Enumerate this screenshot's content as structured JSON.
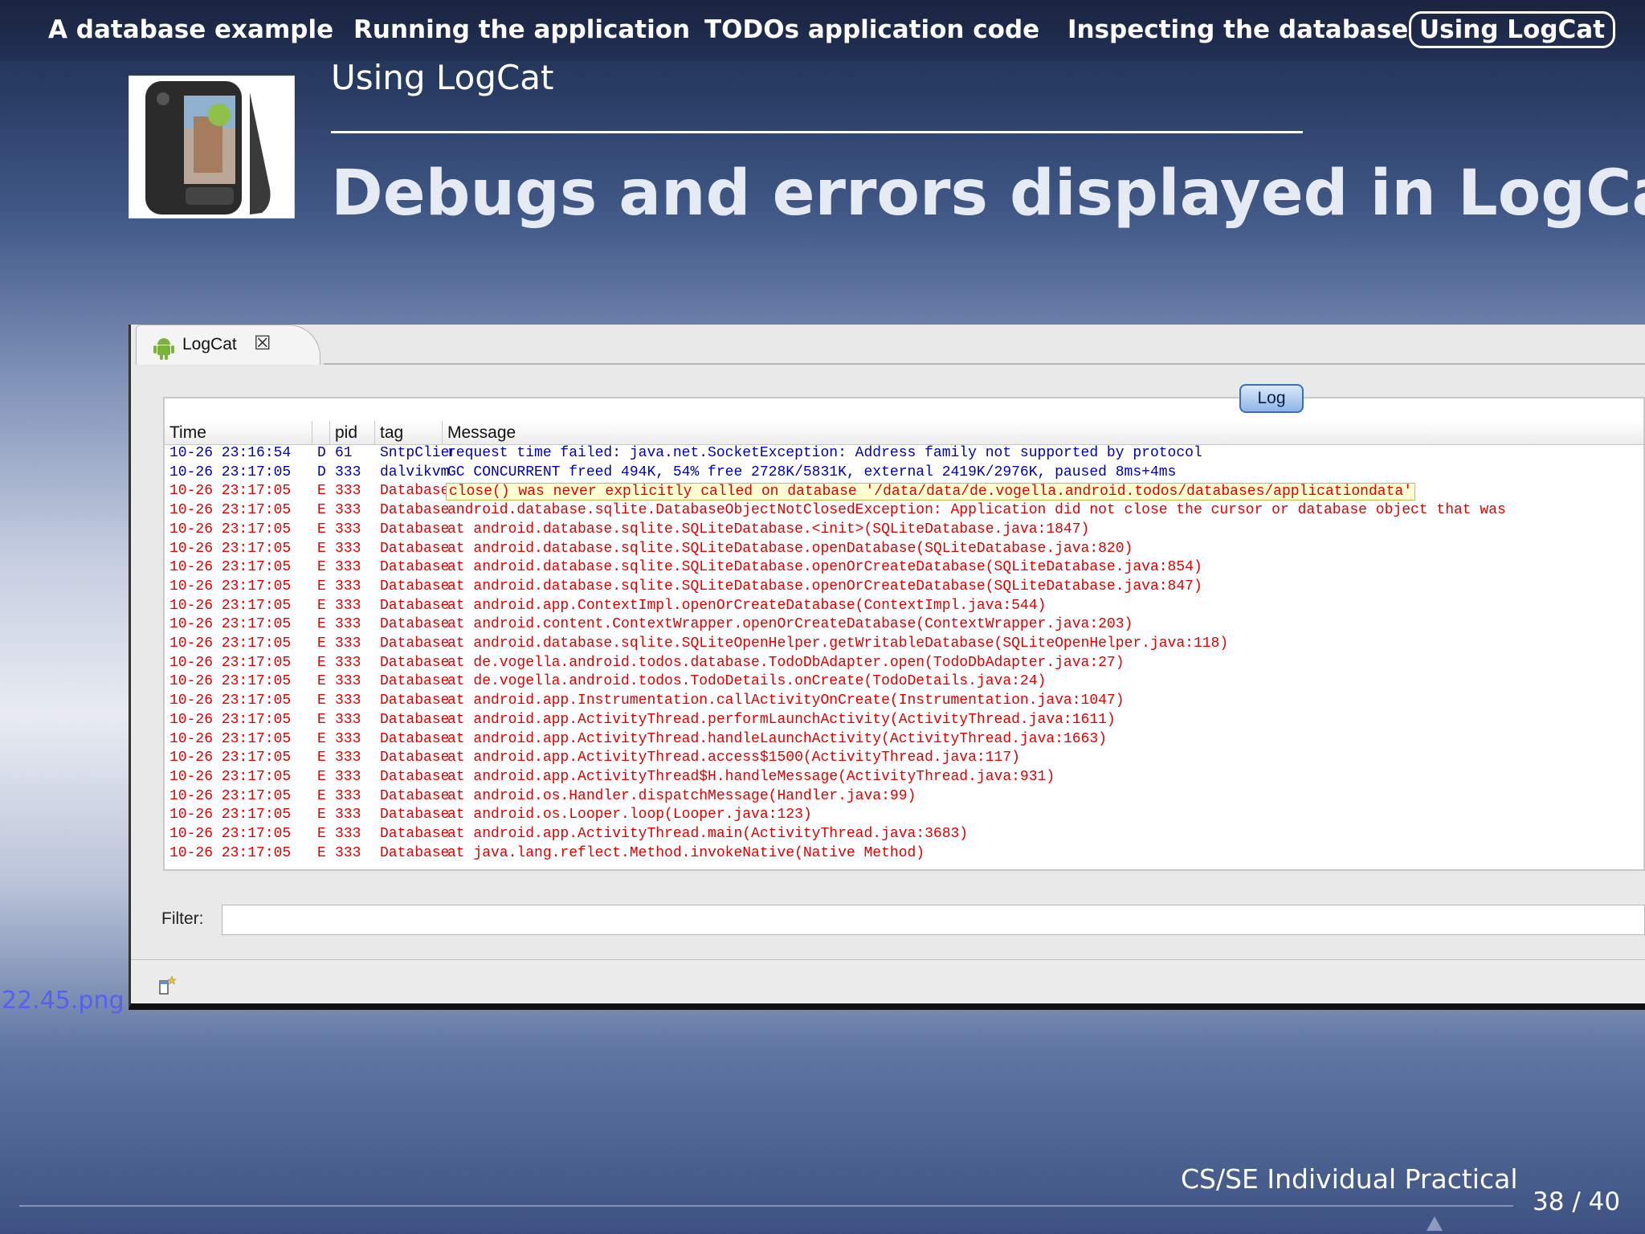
{
  "nav": {
    "items": [
      {
        "label": "A database example"
      },
      {
        "label": "Running the application"
      },
      {
        "label": "TODOs application code"
      },
      {
        "label": "Inspecting the database"
      },
      {
        "label": "Using LogCat"
      }
    ],
    "active_index": 4
  },
  "slide": {
    "subtitle": "Using LogCat",
    "title": "Debugs and errors displayed in LogCat",
    "image_caption": "22.45.png",
    "footer": "CS/SE Individual Practical",
    "page_current": "38",
    "page_separator": "/",
    "page_total": "40"
  },
  "logcat": {
    "tab_label": "LogCat",
    "log_button": "Log",
    "columns": [
      "Time",
      "pid",
      "tag",
      "Message"
    ],
    "filter_label": "Filter:",
    "filter_value": "",
    "rows": [
      {
        "time": "10-26 23:16:54",
        "level": "D",
        "pid": "61",
        "tag": "SntpClient",
        "msg": "request time failed: java.net.SocketException: Address family not supported by protocol",
        "color": "#0000b0"
      },
      {
        "time": "10-26 23:17:05",
        "level": "D",
        "pid": "333",
        "tag": "dalvikvm",
        "msg": "GC CONCURRENT freed 494K, 54% free 2728K/5831K, external 2419K/2976K, paused 8ms+4ms",
        "color": "#0000b0"
      },
      {
        "time": "10-26 23:17:05",
        "level": "E",
        "pid": "333",
        "tag": "Database",
        "msg": "close() was never explicitly called on database '/data/data/de.vogella.android.todos/databases/applicationdata'",
        "color": "#e00000",
        "highlight": true
      },
      {
        "time": "10-26 23:17:05",
        "level": "E",
        "pid": "333",
        "tag": "Database",
        "msg": "android.database.sqlite.DatabaseObjectNotClosedException: Application did not close the cursor or database object that was",
        "color": "#e00000"
      },
      {
        "time": "10-26 23:17:05",
        "level": "E",
        "pid": "333",
        "tag": "Database",
        "msg": "    at android.database.sqlite.SQLiteDatabase.<init>(SQLiteDatabase.java:1847)",
        "color": "#e00000"
      },
      {
        "time": "10-26 23:17:05",
        "level": "E",
        "pid": "333",
        "tag": "Database",
        "msg": "    at android.database.sqlite.SQLiteDatabase.openDatabase(SQLiteDatabase.java:820)",
        "color": "#e00000"
      },
      {
        "time": "10-26 23:17:05",
        "level": "E",
        "pid": "333",
        "tag": "Database",
        "msg": "    at android.database.sqlite.SQLiteDatabase.openOrCreateDatabase(SQLiteDatabase.java:854)",
        "color": "#e00000"
      },
      {
        "time": "10-26 23:17:05",
        "level": "E",
        "pid": "333",
        "tag": "Database",
        "msg": "    at android.database.sqlite.SQLiteDatabase.openOrCreateDatabase(SQLiteDatabase.java:847)",
        "color": "#e00000"
      },
      {
        "time": "10-26 23:17:05",
        "level": "E",
        "pid": "333",
        "tag": "Database",
        "msg": "    at android.app.ContextImpl.openOrCreateDatabase(ContextImpl.java:544)",
        "color": "#e00000"
      },
      {
        "time": "10-26 23:17:05",
        "level": "E",
        "pid": "333",
        "tag": "Database",
        "msg": "    at android.content.ContextWrapper.openOrCreateDatabase(ContextWrapper.java:203)",
        "color": "#e00000"
      },
      {
        "time": "10-26 23:17:05",
        "level": "E",
        "pid": "333",
        "tag": "Database",
        "msg": "    at android.database.sqlite.SQLiteOpenHelper.getWritableDatabase(SQLiteOpenHelper.java:118)",
        "color": "#e00000"
      },
      {
        "time": "10-26 23:17:05",
        "level": "E",
        "pid": "333",
        "tag": "Database",
        "msg": "    at de.vogella.android.todos.database.TodoDbAdapter.open(TodoDbAdapter.java:27)",
        "color": "#e00000"
      },
      {
        "time": "10-26 23:17:05",
        "level": "E",
        "pid": "333",
        "tag": "Database",
        "msg": "    at de.vogella.android.todos.TodoDetails.onCreate(TodoDetails.java:24)",
        "color": "#e00000"
      },
      {
        "time": "10-26 23:17:05",
        "level": "E",
        "pid": "333",
        "tag": "Database",
        "msg": "    at android.app.Instrumentation.callActivityOnCreate(Instrumentation.java:1047)",
        "color": "#e00000"
      },
      {
        "time": "10-26 23:17:05",
        "level": "E",
        "pid": "333",
        "tag": "Database",
        "msg": "    at android.app.ActivityThread.performLaunchActivity(ActivityThread.java:1611)",
        "color": "#e00000"
      },
      {
        "time": "10-26 23:17:05",
        "level": "E",
        "pid": "333",
        "tag": "Database",
        "msg": "    at android.app.ActivityThread.handleLaunchActivity(ActivityThread.java:1663)",
        "color": "#e00000"
      },
      {
        "time": "10-26 23:17:05",
        "level": "E",
        "pid": "333",
        "tag": "Database",
        "msg": "    at android.app.ActivityThread.access$1500(ActivityThread.java:117)",
        "color": "#e00000"
      },
      {
        "time": "10-26 23:17:05",
        "level": "E",
        "pid": "333",
        "tag": "Database",
        "msg": "    at android.app.ActivityThread$H.handleMessage(ActivityThread.java:931)",
        "color": "#e00000"
      },
      {
        "time": "10-26 23:17:05",
        "level": "E",
        "pid": "333",
        "tag": "Database",
        "msg": "    at android.os.Handler.dispatchMessage(Handler.java:99)",
        "color": "#e00000"
      },
      {
        "time": "10-26 23:17:05",
        "level": "E",
        "pid": "333",
        "tag": "Database",
        "msg": "    at android.os.Looper.loop(Looper.java:123)",
        "color": "#e00000"
      },
      {
        "time": "10-26 23:17:05",
        "level": "E",
        "pid": "333",
        "tag": "Database",
        "msg": "    at android.app.ActivityThread.main(ActivityThread.java:3683)",
        "color": "#e00000"
      },
      {
        "time": "10-26 23:17:05",
        "level": "E",
        "pid": "333",
        "tag": "Database",
        "msg": "    at java.lang.reflect.Method.invokeNative(Native Method)",
        "color": "#e00000"
      }
    ]
  },
  "icons": {
    "tab": "android-icon",
    "close": "close-icon",
    "status": "new-console-icon",
    "nav": "navigation-triangle-icon"
  }
}
